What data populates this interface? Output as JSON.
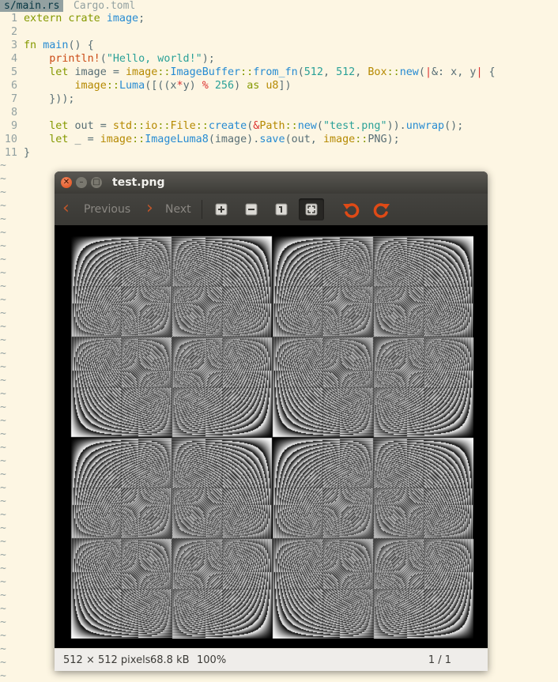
{
  "editor": {
    "tabs": [
      {
        "label": "s/main.rs",
        "active": true
      },
      {
        "label": "Cargo.toml",
        "active": false
      }
    ],
    "line_numbers": [
      "1",
      "2",
      "3",
      "4",
      "5",
      "6",
      "7",
      "8",
      "9",
      "10",
      "11"
    ],
    "lines": [
      [
        {
          "t": "extern crate ",
          "c": "kw"
        },
        {
          "t": "image",
          "c": "fn"
        },
        {
          "t": ";",
          "c": "pn"
        }
      ],
      [],
      [
        {
          "t": "fn ",
          "c": "kw"
        },
        {
          "t": "main",
          "c": "fn"
        },
        {
          "t": "() {",
          "c": "pn"
        }
      ],
      [
        {
          "t": "    ",
          "c": "pn"
        },
        {
          "t": "println!",
          "c": "mac"
        },
        {
          "t": "(",
          "c": "pn"
        },
        {
          "t": "\"Hello, world!\"",
          "c": "st"
        },
        {
          "t": ");",
          "c": "pn"
        }
      ],
      [
        {
          "t": "    ",
          "c": "pn"
        },
        {
          "t": "let ",
          "c": "kw"
        },
        {
          "t": "image = ",
          "c": "pn"
        },
        {
          "t": "image",
          "c": "ty"
        },
        {
          "t": "::",
          "c": "kw"
        },
        {
          "t": "ImageBuffer",
          "c": "fn"
        },
        {
          "t": "::",
          "c": "kw"
        },
        {
          "t": "from_fn",
          "c": "fn"
        },
        {
          "t": "(",
          "c": "pn"
        },
        {
          "t": "512",
          "c": "nm"
        },
        {
          "t": ", ",
          "c": "pn"
        },
        {
          "t": "512",
          "c": "nm"
        },
        {
          "t": ", ",
          "c": "pn"
        },
        {
          "t": "Box",
          "c": "ty"
        },
        {
          "t": "::",
          "c": "kw"
        },
        {
          "t": "new",
          "c": "fn"
        },
        {
          "t": "(",
          "c": "pn"
        },
        {
          "t": "|",
          "c": "pp"
        },
        {
          "t": "&: x, y",
          "c": "pn"
        },
        {
          "t": "|",
          "c": "pp"
        },
        {
          "t": " {",
          "c": "pn"
        }
      ],
      [
        {
          "t": "        ",
          "c": "pn"
        },
        {
          "t": "image",
          "c": "ty"
        },
        {
          "t": "::",
          "c": "kw"
        },
        {
          "t": "Luma",
          "c": "fn"
        },
        {
          "t": "([((x",
          "c": "pn"
        },
        {
          "t": "*",
          "c": "pp"
        },
        {
          "t": "y) ",
          "c": "pn"
        },
        {
          "t": "%",
          "c": "pp"
        },
        {
          "t": " ",
          "c": "pn"
        },
        {
          "t": "256",
          "c": "nm"
        },
        {
          "t": ") ",
          "c": "pn"
        },
        {
          "t": "as",
          "c": "kw"
        },
        {
          "t": " ",
          "c": "pn"
        },
        {
          "t": "u8",
          "c": "ty"
        },
        {
          "t": "])",
          "c": "pn"
        }
      ],
      [
        {
          "t": "    }));",
          "c": "pn"
        }
      ],
      [],
      [
        {
          "t": "    ",
          "c": "pn"
        },
        {
          "t": "let ",
          "c": "kw"
        },
        {
          "t": "out = ",
          "c": "pn"
        },
        {
          "t": "std",
          "c": "ty"
        },
        {
          "t": "::",
          "c": "kw"
        },
        {
          "t": "io",
          "c": "ty"
        },
        {
          "t": "::",
          "c": "kw"
        },
        {
          "t": "File",
          "c": "ty"
        },
        {
          "t": "::",
          "c": "kw"
        },
        {
          "t": "create",
          "c": "fn"
        },
        {
          "t": "(",
          "c": "pn"
        },
        {
          "t": "&",
          "c": "pp"
        },
        {
          "t": "Path",
          "c": "ty"
        },
        {
          "t": "::",
          "c": "kw"
        },
        {
          "t": "new",
          "c": "fn"
        },
        {
          "t": "(",
          "c": "pn"
        },
        {
          "t": "\"test.png\"",
          "c": "st"
        },
        {
          "t": ")).",
          "c": "pn"
        },
        {
          "t": "unwrap",
          "c": "fn"
        },
        {
          "t": "();",
          "c": "pn"
        }
      ],
      [
        {
          "t": "    ",
          "c": "pn"
        },
        {
          "t": "let ",
          "c": "kw"
        },
        {
          "t": "_ = ",
          "c": "pn"
        },
        {
          "t": "image",
          "c": "ty"
        },
        {
          "t": "::",
          "c": "kw"
        },
        {
          "t": "ImageLuma8",
          "c": "fn"
        },
        {
          "t": "(image).",
          "c": "pn"
        },
        {
          "t": "save",
          "c": "fn"
        },
        {
          "t": "(out, ",
          "c": "pn"
        },
        {
          "t": "image",
          "c": "ty"
        },
        {
          "t": "::",
          "c": "kw"
        },
        {
          "t": "PNG",
          "c": "pn"
        },
        {
          "t": ");",
          "c": "pn"
        }
      ],
      [
        {
          "t": "}",
          "c": "pn"
        }
      ]
    ],
    "tilde": "~"
  },
  "viewer": {
    "title": "test.png",
    "previous_label": "Previous",
    "next_label": "Next",
    "status": {
      "dimensions": "512 × 512 pixels",
      "file_size": "68.8 kB",
      "zoom": "100%",
      "page": "1 / 1"
    },
    "accent_color": "#df4a16"
  }
}
